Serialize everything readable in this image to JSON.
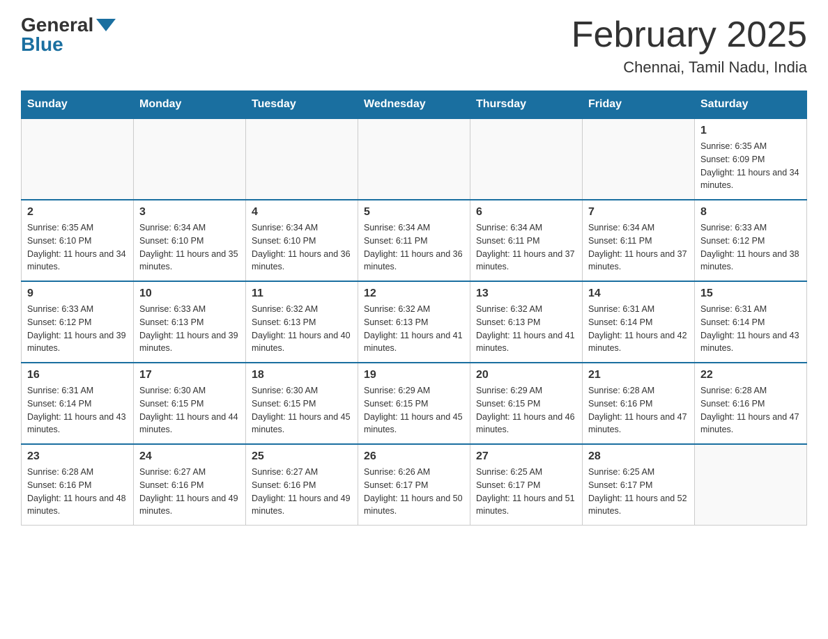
{
  "header": {
    "logo_general": "General",
    "logo_blue": "Blue",
    "month_title": "February 2025",
    "location": "Chennai, Tamil Nadu, India"
  },
  "days_of_week": [
    "Sunday",
    "Monday",
    "Tuesday",
    "Wednesday",
    "Thursday",
    "Friday",
    "Saturday"
  ],
  "weeks": [
    [
      {
        "day": "",
        "info": ""
      },
      {
        "day": "",
        "info": ""
      },
      {
        "day": "",
        "info": ""
      },
      {
        "day": "",
        "info": ""
      },
      {
        "day": "",
        "info": ""
      },
      {
        "day": "",
        "info": ""
      },
      {
        "day": "1",
        "info": "Sunrise: 6:35 AM\nSunset: 6:09 PM\nDaylight: 11 hours and 34 minutes."
      }
    ],
    [
      {
        "day": "2",
        "info": "Sunrise: 6:35 AM\nSunset: 6:10 PM\nDaylight: 11 hours and 34 minutes."
      },
      {
        "day": "3",
        "info": "Sunrise: 6:34 AM\nSunset: 6:10 PM\nDaylight: 11 hours and 35 minutes."
      },
      {
        "day": "4",
        "info": "Sunrise: 6:34 AM\nSunset: 6:10 PM\nDaylight: 11 hours and 36 minutes."
      },
      {
        "day": "5",
        "info": "Sunrise: 6:34 AM\nSunset: 6:11 PM\nDaylight: 11 hours and 36 minutes."
      },
      {
        "day": "6",
        "info": "Sunrise: 6:34 AM\nSunset: 6:11 PM\nDaylight: 11 hours and 37 minutes."
      },
      {
        "day": "7",
        "info": "Sunrise: 6:34 AM\nSunset: 6:11 PM\nDaylight: 11 hours and 37 minutes."
      },
      {
        "day": "8",
        "info": "Sunrise: 6:33 AM\nSunset: 6:12 PM\nDaylight: 11 hours and 38 minutes."
      }
    ],
    [
      {
        "day": "9",
        "info": "Sunrise: 6:33 AM\nSunset: 6:12 PM\nDaylight: 11 hours and 39 minutes."
      },
      {
        "day": "10",
        "info": "Sunrise: 6:33 AM\nSunset: 6:13 PM\nDaylight: 11 hours and 39 minutes."
      },
      {
        "day": "11",
        "info": "Sunrise: 6:32 AM\nSunset: 6:13 PM\nDaylight: 11 hours and 40 minutes."
      },
      {
        "day": "12",
        "info": "Sunrise: 6:32 AM\nSunset: 6:13 PM\nDaylight: 11 hours and 41 minutes."
      },
      {
        "day": "13",
        "info": "Sunrise: 6:32 AM\nSunset: 6:13 PM\nDaylight: 11 hours and 41 minutes."
      },
      {
        "day": "14",
        "info": "Sunrise: 6:31 AM\nSunset: 6:14 PM\nDaylight: 11 hours and 42 minutes."
      },
      {
        "day": "15",
        "info": "Sunrise: 6:31 AM\nSunset: 6:14 PM\nDaylight: 11 hours and 43 minutes."
      }
    ],
    [
      {
        "day": "16",
        "info": "Sunrise: 6:31 AM\nSunset: 6:14 PM\nDaylight: 11 hours and 43 minutes."
      },
      {
        "day": "17",
        "info": "Sunrise: 6:30 AM\nSunset: 6:15 PM\nDaylight: 11 hours and 44 minutes."
      },
      {
        "day": "18",
        "info": "Sunrise: 6:30 AM\nSunset: 6:15 PM\nDaylight: 11 hours and 45 minutes."
      },
      {
        "day": "19",
        "info": "Sunrise: 6:29 AM\nSunset: 6:15 PM\nDaylight: 11 hours and 45 minutes."
      },
      {
        "day": "20",
        "info": "Sunrise: 6:29 AM\nSunset: 6:15 PM\nDaylight: 11 hours and 46 minutes."
      },
      {
        "day": "21",
        "info": "Sunrise: 6:28 AM\nSunset: 6:16 PM\nDaylight: 11 hours and 47 minutes."
      },
      {
        "day": "22",
        "info": "Sunrise: 6:28 AM\nSunset: 6:16 PM\nDaylight: 11 hours and 47 minutes."
      }
    ],
    [
      {
        "day": "23",
        "info": "Sunrise: 6:28 AM\nSunset: 6:16 PM\nDaylight: 11 hours and 48 minutes."
      },
      {
        "day": "24",
        "info": "Sunrise: 6:27 AM\nSunset: 6:16 PM\nDaylight: 11 hours and 49 minutes."
      },
      {
        "day": "25",
        "info": "Sunrise: 6:27 AM\nSunset: 6:16 PM\nDaylight: 11 hours and 49 minutes."
      },
      {
        "day": "26",
        "info": "Sunrise: 6:26 AM\nSunset: 6:17 PM\nDaylight: 11 hours and 50 minutes."
      },
      {
        "day": "27",
        "info": "Sunrise: 6:25 AM\nSunset: 6:17 PM\nDaylight: 11 hours and 51 minutes."
      },
      {
        "day": "28",
        "info": "Sunrise: 6:25 AM\nSunset: 6:17 PM\nDaylight: 11 hours and 52 minutes."
      },
      {
        "day": "",
        "info": ""
      }
    ]
  ]
}
